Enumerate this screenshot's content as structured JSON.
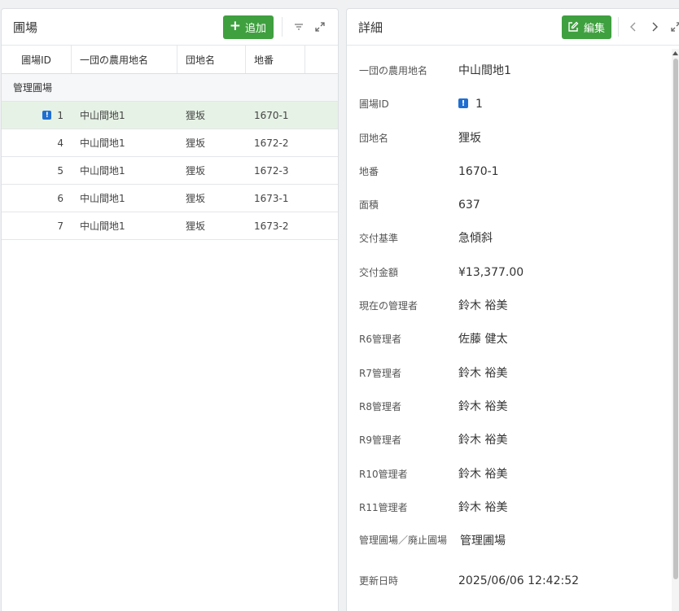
{
  "left_panel": {
    "title": "圃場",
    "add_label": "追加",
    "columns": [
      "圃場ID",
      "一団の農用地名",
      "団地名",
      "地番"
    ],
    "group_label": "管理圃場",
    "rows": [
      {
        "id": "1",
        "name": "中山間地1",
        "danchi": "狸坂",
        "chiban": "1670-1",
        "warning": true
      },
      {
        "id": "4",
        "name": "中山間地1",
        "danchi": "狸坂",
        "chiban": "1672-2",
        "warning": false
      },
      {
        "id": "5",
        "name": "中山間地1",
        "danchi": "狸坂",
        "chiban": "1672-3",
        "warning": false
      },
      {
        "id": "6",
        "name": "中山間地1",
        "danchi": "狸坂",
        "chiban": "1673-1",
        "warning": false
      },
      {
        "id": "7",
        "name": "中山間地1",
        "danchi": "狸坂",
        "chiban": "1673-2",
        "warning": false
      }
    ]
  },
  "right_panel": {
    "title": "詳細",
    "edit_label": "編集",
    "fields": [
      {
        "label": "一団の農用地名",
        "value": "中山間地1"
      },
      {
        "label": "圃場ID",
        "value": "1",
        "warning": true
      },
      {
        "label": "団地名",
        "value": "狸坂"
      },
      {
        "label": "地番",
        "value": "1670-1"
      },
      {
        "label": "面積",
        "value": "637"
      },
      {
        "label": "交付基準",
        "value": "急傾斜"
      },
      {
        "label": "交付金額",
        "value": "¥13,377.00"
      },
      {
        "label": "現在の管理者",
        "value": "鈴木 裕美"
      },
      {
        "label": "R6管理者",
        "value": "佐藤 健太"
      },
      {
        "label": "R7管理者",
        "value": "鈴木 裕美"
      },
      {
        "label": "R8管理者",
        "value": "鈴木 裕美"
      },
      {
        "label": "R9管理者",
        "value": "鈴木 裕美"
      },
      {
        "label": "R10管理者",
        "value": "鈴木 裕美"
      },
      {
        "label": "R11管理者",
        "value": "鈴木 裕美"
      },
      {
        "label": "管理圃場／廃止圃場",
        "value": "管理圃場"
      },
      {
        "label": "更新日時",
        "value": "2025/06/06 12:42:52"
      }
    ]
  },
  "colors": {
    "accent_green": "#3fa03f",
    "selected_row": "#e6f2e5",
    "warning_blue": "#1f6fd1"
  },
  "icons": {
    "add": "plus-icon",
    "filter": "filter-icon",
    "expand": "expand-icon",
    "edit": "edit-icon",
    "prev": "chevron-left-icon",
    "next": "chevron-right-icon",
    "warning": "warning-icon"
  }
}
